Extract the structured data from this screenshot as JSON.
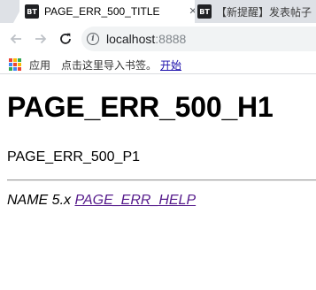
{
  "tabs": [
    {
      "title": "PAGE_ERR_500_TITLE",
      "favicon": "BT",
      "active": true
    },
    {
      "title": "【新提醒】发表帖子",
      "favicon": "BT",
      "active": false
    }
  ],
  "toolbar": {
    "url_host": "localhost",
    "url_port": ":8888"
  },
  "bookmarks": {
    "apps_label": "应用",
    "hint": "点击这里导入书签。",
    "import_link": "开始"
  },
  "page": {
    "h1": "PAGE_ERR_500_H1",
    "p1": "PAGE_ERR_500_P1",
    "footer_name": "NAME 5.x",
    "footer_link": "PAGE_ERR_HELP"
  },
  "colors": {
    "tab_strip": "#dee1e6",
    "link_visited": "#551a8b",
    "apps_grid": [
      "#ea4335",
      "#fbbc04",
      "#34a853",
      "#4285f4",
      "#ea4335",
      "#fbbc04",
      "#34a853",
      "#4285f4",
      "#ea4335"
    ]
  }
}
